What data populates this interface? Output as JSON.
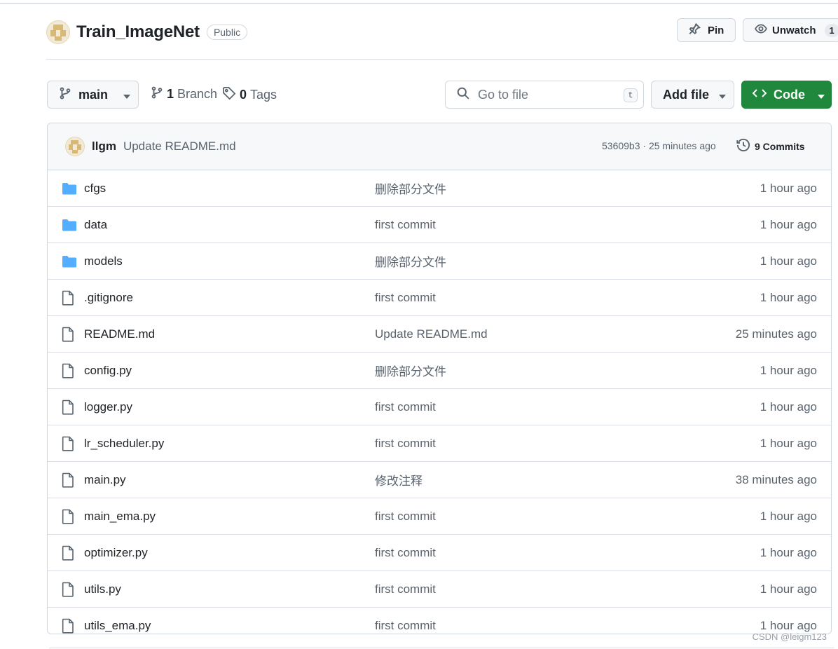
{
  "repo": {
    "name": "Train_ImageNet",
    "visibility": "Public"
  },
  "actions": {
    "pin_label": "Pin",
    "watch_label": "Unwatch",
    "watch_count": "1"
  },
  "toolbar": {
    "branch": "main",
    "branch_count": "1",
    "branch_label": "Branch",
    "tag_count": "0",
    "tag_label": "Tags",
    "search_placeholder": "Go to file",
    "search_shortcut": "t",
    "add_file_label": "Add file",
    "code_label": "Code"
  },
  "latest_commit": {
    "author": "llgm",
    "message": "Update README.md",
    "hash_time": "53609b3 · 25 minutes ago",
    "commits_label": "9 Commits"
  },
  "files": [
    {
      "type": "folder",
      "name": "cfgs",
      "message": "删除部分文件",
      "time": "1 hour ago"
    },
    {
      "type": "folder",
      "name": "data",
      "message": "first commit",
      "time": "1 hour ago"
    },
    {
      "type": "folder",
      "name": "models",
      "message": "删除部分文件",
      "time": "1 hour ago"
    },
    {
      "type": "file",
      "name": ".gitignore",
      "message": "first commit",
      "time": "1 hour ago"
    },
    {
      "type": "file",
      "name": "README.md",
      "message": "Update README.md",
      "time": "25 minutes ago"
    },
    {
      "type": "file",
      "name": "config.py",
      "message": "删除部分文件",
      "time": "1 hour ago"
    },
    {
      "type": "file",
      "name": "logger.py",
      "message": "first commit",
      "time": "1 hour ago"
    },
    {
      "type": "file",
      "name": "lr_scheduler.py",
      "message": "first commit",
      "time": "1 hour ago"
    },
    {
      "type": "file",
      "name": "main.py",
      "message": "修改注释",
      "time": "38 minutes ago"
    },
    {
      "type": "file",
      "name": "main_ema.py",
      "message": "first commit",
      "time": "1 hour ago"
    },
    {
      "type": "file",
      "name": "optimizer.py",
      "message": "first commit",
      "time": "1 hour ago"
    },
    {
      "type": "file",
      "name": "utils.py",
      "message": "first commit",
      "time": "1 hour ago"
    },
    {
      "type": "file",
      "name": "utils_ema.py",
      "message": "first commit",
      "time": "1 hour ago"
    }
  ],
  "watermark": "CSDN @leigm123",
  "colors": {
    "folder": "#54aeff",
    "code_button": "#1f883d",
    "file_icon": "#59636e"
  }
}
